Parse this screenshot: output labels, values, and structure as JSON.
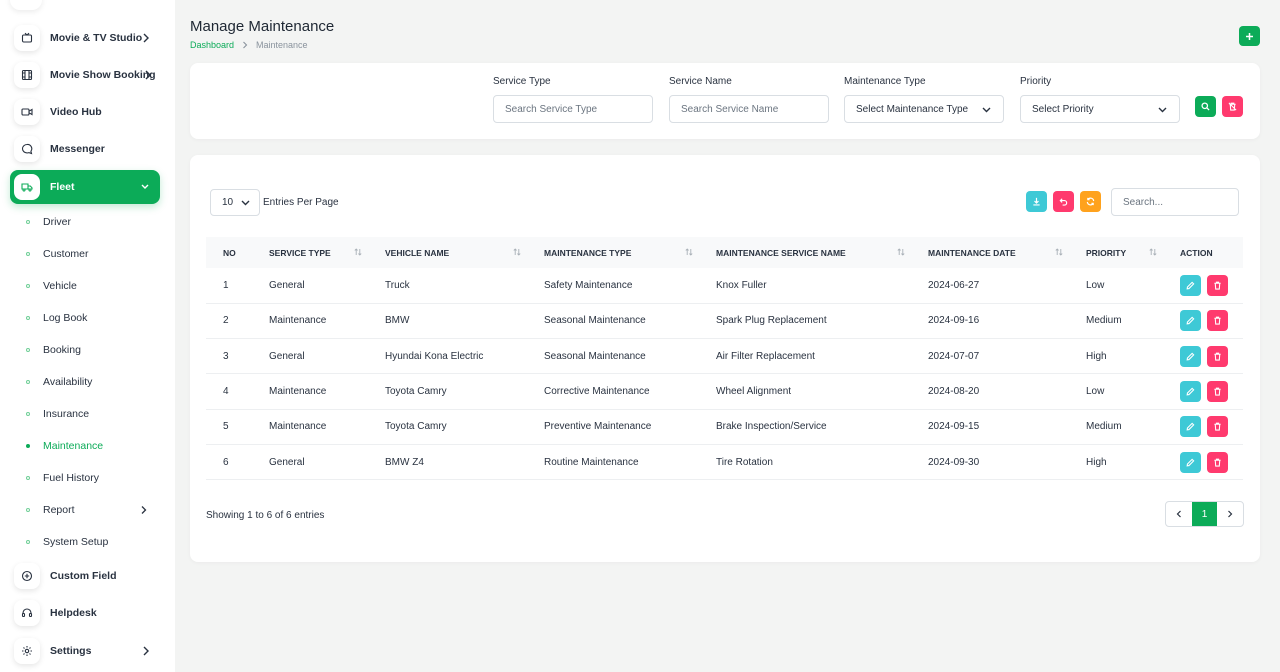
{
  "sidebar": {
    "items": [
      {
        "label": "Movie & TV Studio",
        "icon": "tv-icon",
        "has_arrow": true
      },
      {
        "label": "Movie Show Booking",
        "icon": "film-icon",
        "has_arrow": true
      },
      {
        "label": "Video Hub",
        "icon": "video-icon",
        "has_arrow": false
      },
      {
        "label": "Messenger",
        "icon": "chat-icon",
        "has_arrow": false
      },
      {
        "label": "Fleet",
        "icon": "truck-icon",
        "has_arrow": true,
        "active": true
      }
    ],
    "fleet_sub": [
      {
        "label": "Driver"
      },
      {
        "label": "Customer"
      },
      {
        "label": "Vehicle"
      },
      {
        "label": "Log Book"
      },
      {
        "label": "Booking"
      },
      {
        "label": "Availability"
      },
      {
        "label": "Insurance"
      },
      {
        "label": "Maintenance",
        "active": true
      },
      {
        "label": "Fuel History"
      },
      {
        "label": "Report",
        "has_arrow": true
      },
      {
        "label": "System Setup"
      }
    ],
    "bottom_items": [
      {
        "label": "Custom Field",
        "icon": "plus-circle-icon"
      },
      {
        "label": "Helpdesk",
        "icon": "headset-icon"
      },
      {
        "label": "Settings",
        "icon": "gear-icon",
        "has_arrow": true
      }
    ]
  },
  "header": {
    "title": "Manage Maintenance",
    "breadcrumb": {
      "home": "Dashboard",
      "current": "Maintenance"
    }
  },
  "filters": {
    "service_type": {
      "label": "Service Type",
      "placeholder": "Search Service Type"
    },
    "service_name": {
      "label": "Service Name",
      "placeholder": "Search Service Name"
    },
    "maintenance_type": {
      "label": "Maintenance Type",
      "value": "Select Maintenance Type"
    },
    "priority": {
      "label": "Priority",
      "value": "Select Priority"
    }
  },
  "table_controls": {
    "per_page": "10",
    "per_page_label": "Entries Per Page",
    "search_placeholder": "Search..."
  },
  "table": {
    "columns": [
      "NO",
      "SERVICE TYPE",
      "VEHICLE NAME",
      "MAINTENANCE TYPE",
      "MAINTENANCE SERVICE NAME",
      "MAINTENANCE DATE",
      "PRIORITY",
      "ACTION"
    ],
    "rows": [
      [
        "1",
        "General",
        "Truck",
        "Safety Maintenance",
        "Knox Fuller",
        "2024-06-27",
        "Low"
      ],
      [
        "2",
        "Maintenance",
        "BMW",
        "Seasonal Maintenance",
        "Spark Plug Replacement",
        "2024-09-16",
        "Medium"
      ],
      [
        "3",
        "General",
        "Hyundai Kona Electric",
        "Seasonal Maintenance",
        "Air Filter Replacement",
        "2024-07-07",
        "High"
      ],
      [
        "4",
        "Maintenance",
        "Toyota Camry",
        "Corrective Maintenance",
        "Wheel Alignment",
        "2024-08-20",
        "Low"
      ],
      [
        "5",
        "Maintenance",
        "Toyota Camry",
        "Preventive Maintenance",
        "Brake Inspection/Service",
        "2024-09-15",
        "Medium"
      ],
      [
        "6",
        "General",
        "BMW Z4",
        "Routine Maintenance",
        "Tire Rotation",
        "2024-09-30",
        "High"
      ]
    ]
  },
  "footer": {
    "showing": "Showing 1 to 6 of 6 entries",
    "current_page": "1"
  },
  "colors": {
    "primary": "#0cab58",
    "info": "#3ec9d6",
    "danger": "#ff3a6e",
    "warning": "#ffa21d"
  }
}
